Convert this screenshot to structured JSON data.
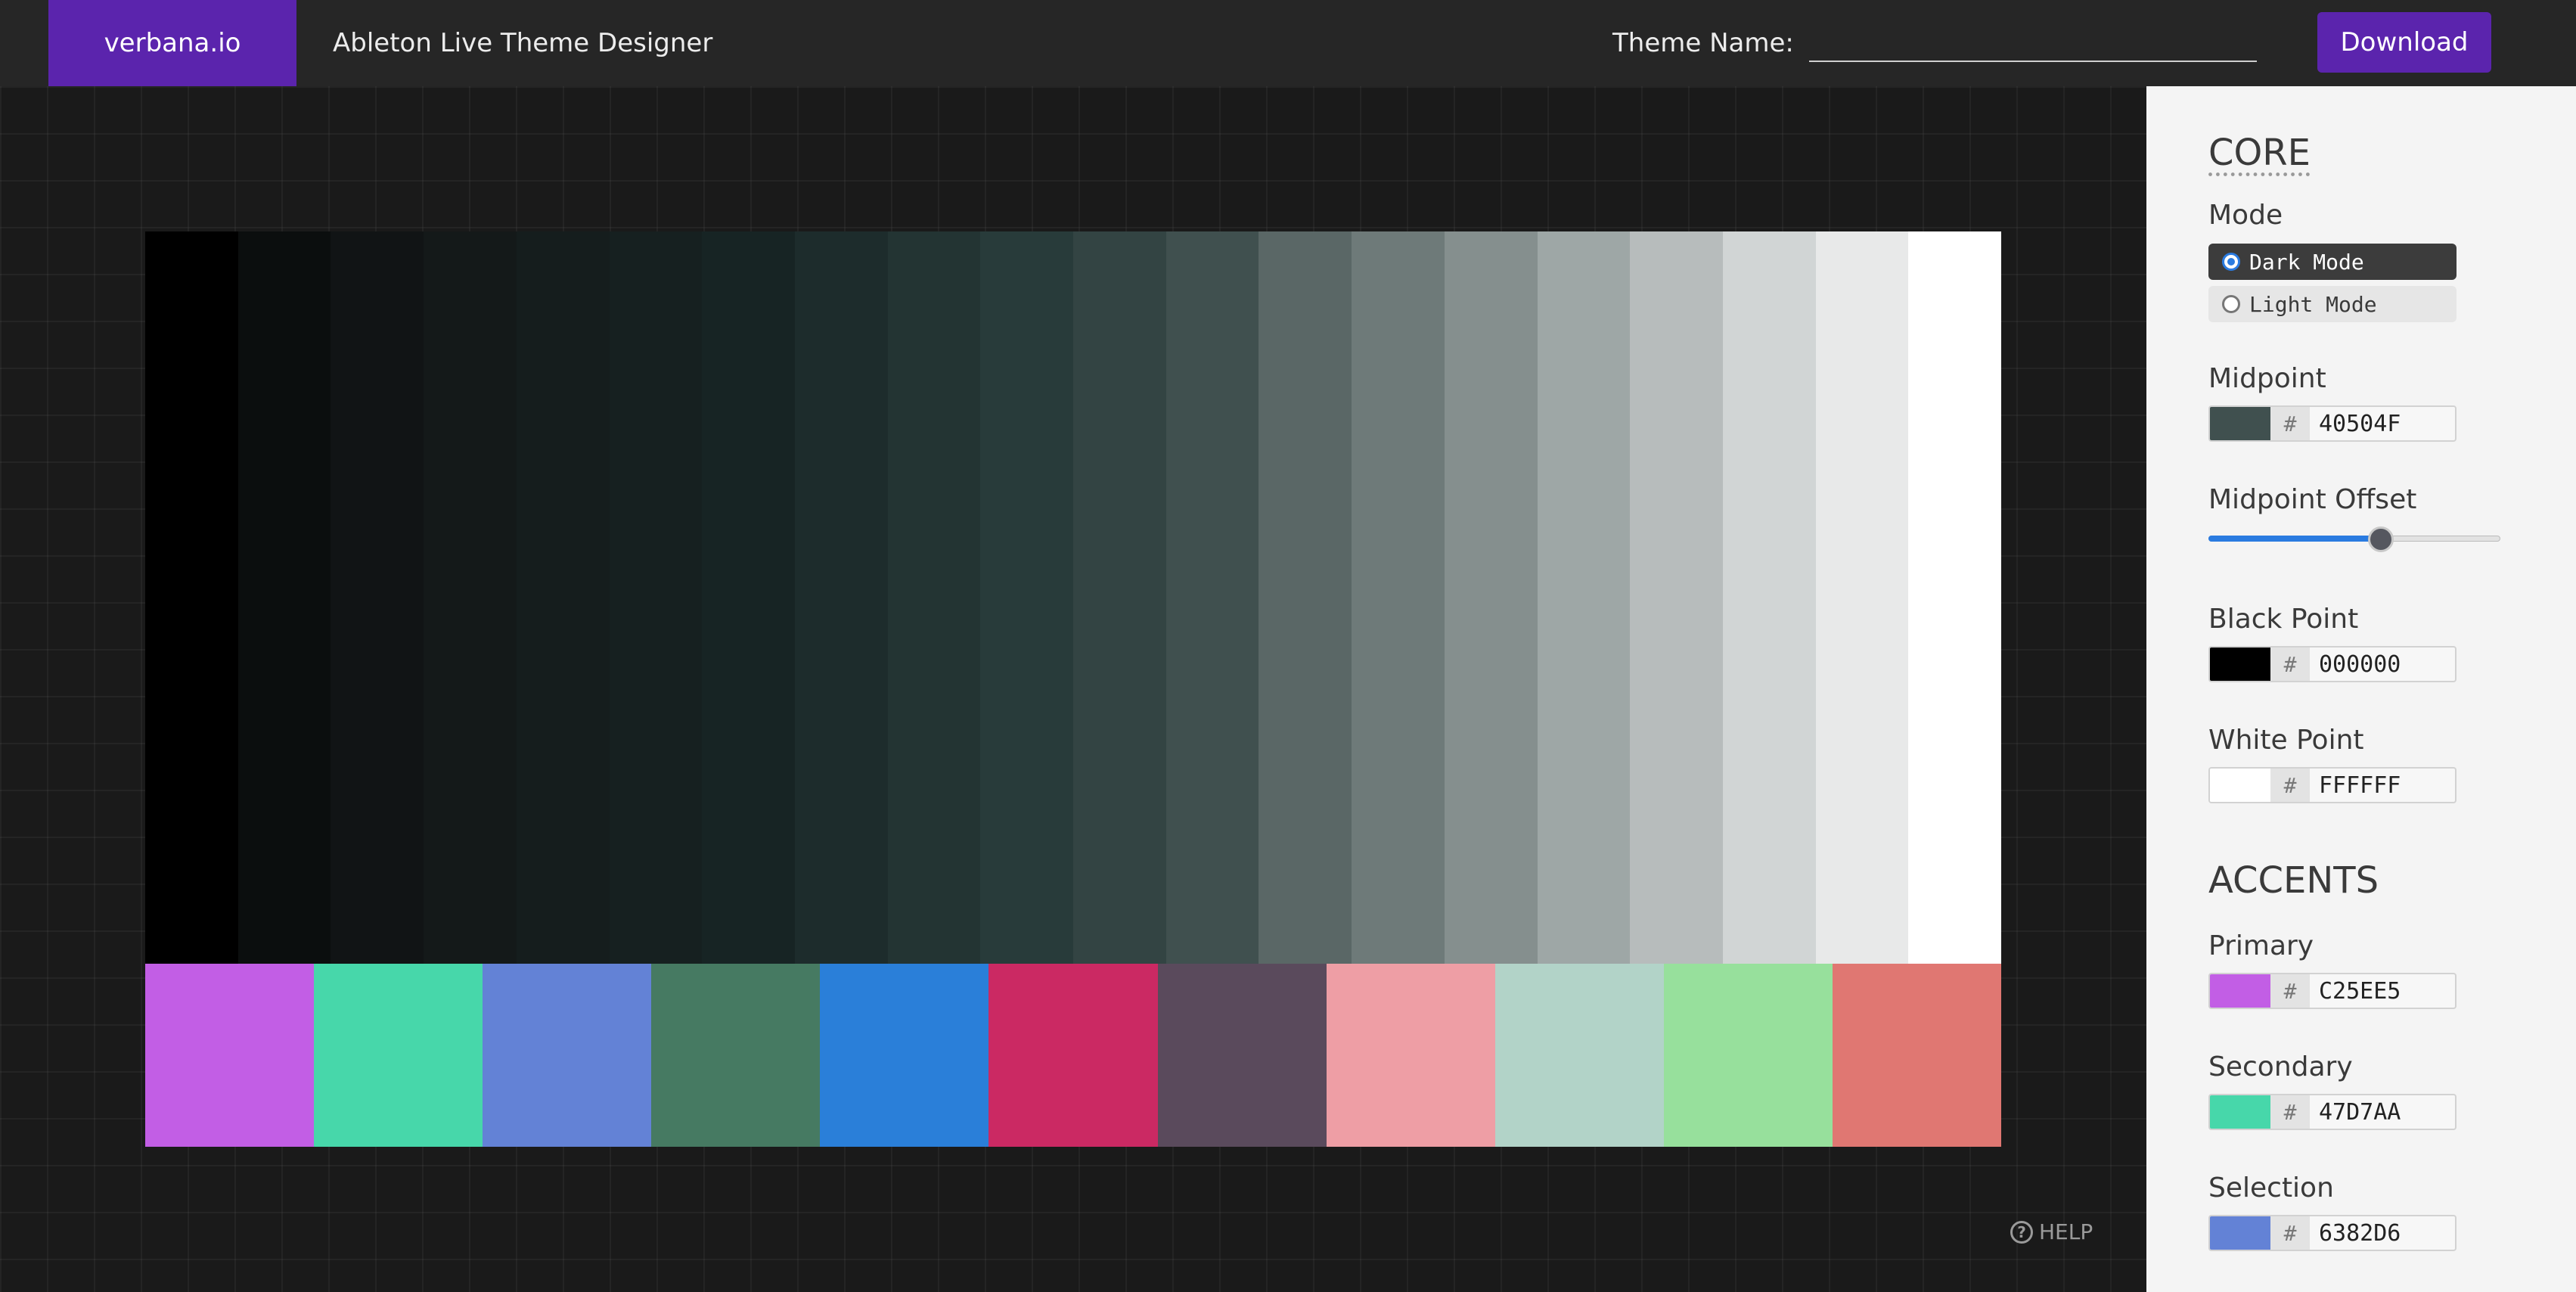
{
  "header": {
    "brand": "verbana.io",
    "app_title": "Ableton Live Theme Designer",
    "theme_name_label": "Theme Name:",
    "theme_name_value": "",
    "download_label": "Download",
    "brand_color": "#5b24ad"
  },
  "preview": {
    "gray_ramp": [
      "#000000",
      "#0b0e0e",
      "#111415",
      "#141919",
      "#151d1d",
      "#162020",
      "#172424",
      "#1d2c2c",
      "#233433",
      "#283b3a",
      "#334443",
      "#40504f",
      "#5a6766",
      "#6e7a79",
      "#858f8e",
      "#9ea7a6",
      "#b7bcbc",
      "#d1d5d5",
      "#e8e9e9",
      "#ffffff"
    ],
    "accent_swatches": [
      "#c25ee5",
      "#47d7aa",
      "#6382d6",
      "#467a62",
      "#2a7fd9",
      "#cb2963",
      "#5a4a5c",
      "#ee9ea5",
      "#b2d3c8",
      "#97e09c",
      "#e07772"
    ]
  },
  "help": {
    "label": "HELP",
    "icon": "question-circle-icon"
  },
  "panel": {
    "core_title": "CORE",
    "mode": {
      "label": "Mode",
      "options": [
        "Dark Mode",
        "Light Mode"
      ],
      "selected": "Dark Mode"
    },
    "midpoint": {
      "label": "Midpoint",
      "hex": "40504F",
      "color": "#40504f"
    },
    "midpoint_offset": {
      "label": "Midpoint Offset",
      "value": 0.59
    },
    "black_point": {
      "label": "Black Point",
      "hex": "000000",
      "color": "#000000"
    },
    "white_point": {
      "label": "White Point",
      "hex": "FFFFFF",
      "color": "#ffffff"
    },
    "accents_title": "ACCENTS",
    "primary": {
      "label": "Primary",
      "hex": "C25EE5",
      "color": "#c25ee5"
    },
    "secondary": {
      "label": "Secondary",
      "hex": "47D7AA",
      "color": "#47d7aa"
    },
    "selection": {
      "label": "Selection",
      "hex": "6382D6",
      "color": "#6382d6"
    },
    "hash_symbol": "#"
  }
}
